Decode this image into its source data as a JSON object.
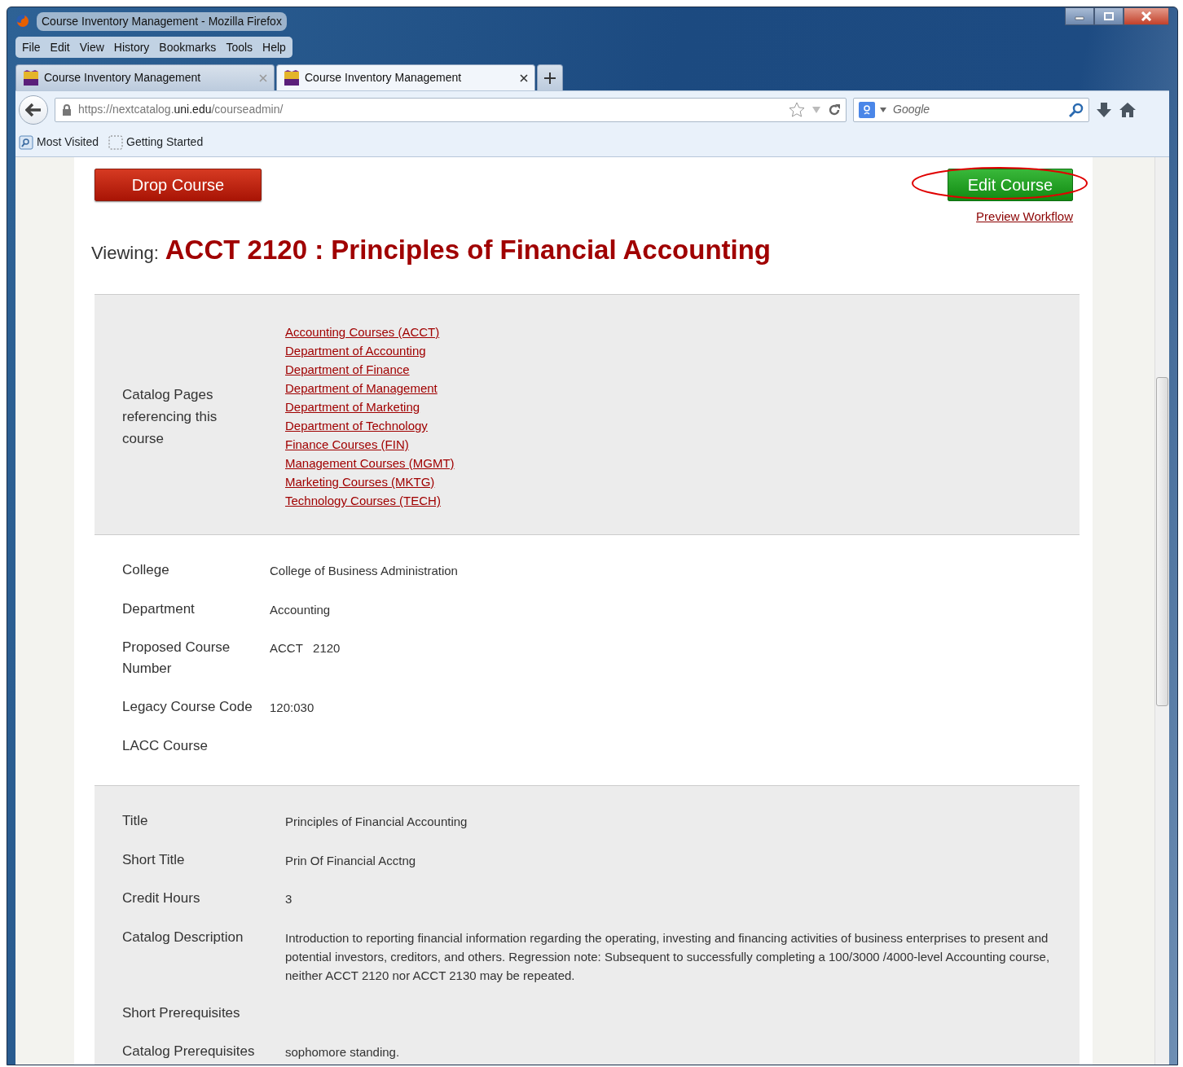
{
  "window": {
    "title": "Course Inventory Management - Mozilla Firefox"
  },
  "menu": [
    "File",
    "Edit",
    "View",
    "History",
    "Bookmarks",
    "Tools",
    "Help"
  ],
  "tabs": [
    {
      "label": "Course Inventory Management",
      "selected": false
    },
    {
      "label": "Course Inventory Management",
      "selected": true
    }
  ],
  "address": {
    "url_parts": [
      {
        "text": "https://nextcatalog.",
        "emphasis": false
      },
      {
        "text": "uni.edu",
        "emphasis": true
      },
      {
        "text": "/courseadmin/",
        "emphasis": false
      }
    ]
  },
  "search": {
    "placeholder": "Google"
  },
  "bookmarks": [
    "Most Visited",
    "Getting Started"
  ],
  "page": {
    "drop_button": "Drop Course",
    "edit_button": {
      "label": "Edit Course",
      "circled": true
    },
    "preview_link": "Preview Workflow",
    "heading_prefix": "Viewing:",
    "heading": "ACCT 2120 : Principles of Financial Accounting",
    "sections": [
      {
        "shaded": true,
        "fields": [
          {
            "label": "Catalog Pages referencing this course",
            "links": [
              "Accounting Courses (ACCT)",
              "Department of Accounting",
              "Department of Finance",
              "Department of Management",
              "Department of Marketing",
              "Department of Technology",
              "Finance Courses (FIN)",
              "Management Courses (MGMT)",
              "Marketing Courses (MKTG)",
              "Technology Courses (TECH)"
            ]
          }
        ]
      },
      {
        "shaded": false,
        "fields": [
          {
            "label": "College",
            "value": "College of Business Administration"
          },
          {
            "label": "Department",
            "value": "Accounting"
          },
          {
            "label": "Proposed Course Number",
            "value": "ACCT   2120"
          },
          {
            "label": "Legacy Course Code",
            "value": "120:030"
          },
          {
            "label": "LACC Course"
          }
        ]
      },
      {
        "shaded": true,
        "fields": [
          {
            "label": "Title",
            "value": "Principles of Financial Accounting"
          },
          {
            "label": "Short Title",
            "value": "Prin Of Financial Acctng"
          },
          {
            "label": "Credit Hours",
            "value": "3"
          },
          {
            "label": "Catalog Description",
            "value": "Introduction to reporting financial information regarding the operating, investing and financing activities of business enterprises to present and potential investors, creditors, and others. Regression note: Subsequent to successfully completing a 100/3000 /4000-level Accounting course, neither ACCT 2120 nor ACCT 2130 may be repeated."
          },
          {
            "label": "Short Prerequisites"
          },
          {
            "label": "Catalog Prerequisites",
            "value": "sophomore standing."
          }
        ]
      }
    ]
  }
}
